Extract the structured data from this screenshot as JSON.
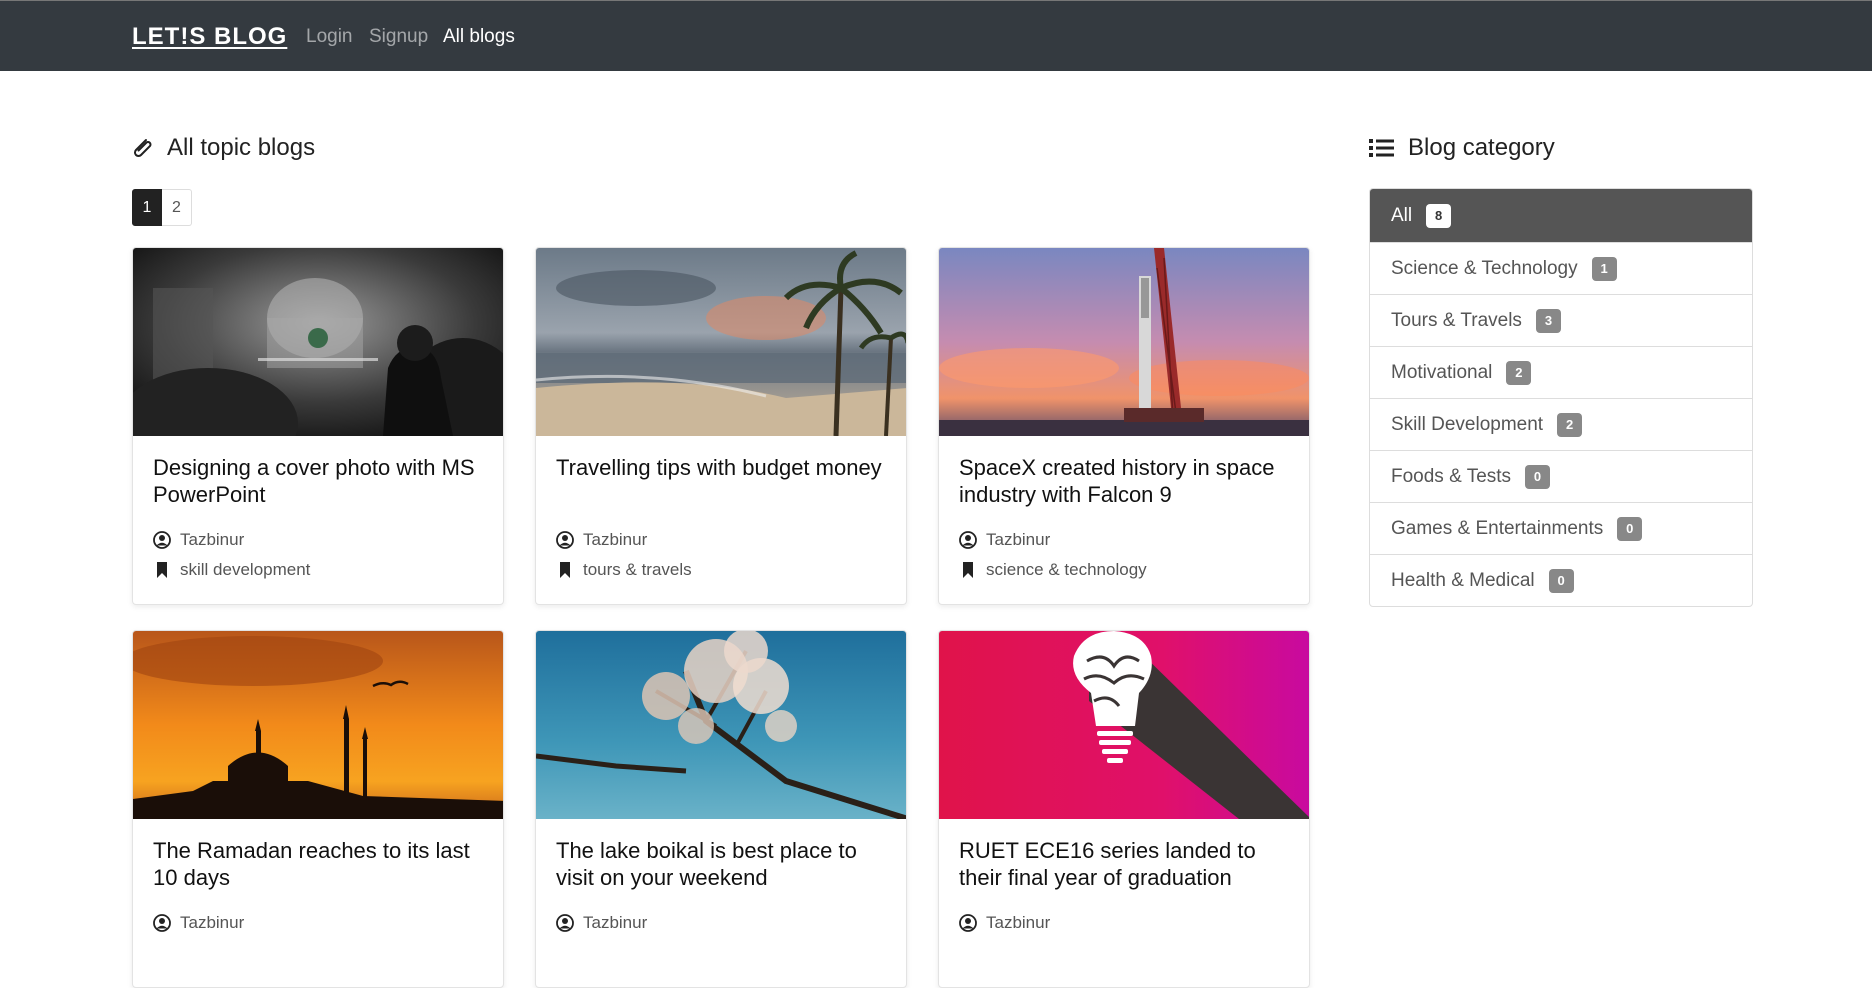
{
  "navbar": {
    "brand": "LET!S BLOG",
    "links": [
      "Login",
      "Signup",
      "All blogs"
    ]
  },
  "main": {
    "title": "All topic blogs",
    "pagination": [
      "1",
      "2"
    ],
    "posts": [
      {
        "title": "Designing a cover photo with MS PowerPoint",
        "author": "Tazbinur",
        "category": "skill development"
      },
      {
        "title": "Travelling tips with budget money",
        "author": "Tazbinur",
        "category": "tours & travels"
      },
      {
        "title": "SpaceX created history in space industry with Falcon 9",
        "author": "Tazbinur",
        "category": "science & technology"
      },
      {
        "title": "The Ramadan reaches to its last 10 days",
        "author": "Tazbinur"
      },
      {
        "title": "The lake boikal is best place to visit on your weekend",
        "author": "Tazbinur"
      },
      {
        "title": "RUET ECE16 series landed to their final year of graduation",
        "author": "Tazbinur"
      }
    ]
  },
  "sidebar": {
    "title": "Blog category",
    "categories": [
      {
        "label": "All",
        "count": "8"
      },
      {
        "label": "Science & Technology",
        "count": "1"
      },
      {
        "label": "Tours & Travels",
        "count": "3"
      },
      {
        "label": "Motivational",
        "count": "2"
      },
      {
        "label": "Skill Development",
        "count": "2"
      },
      {
        "label": "Foods & Tests",
        "count": "0"
      },
      {
        "label": "Games & Entertainments",
        "count": "0"
      },
      {
        "label": "Health & Medical",
        "count": "0"
      }
    ]
  }
}
